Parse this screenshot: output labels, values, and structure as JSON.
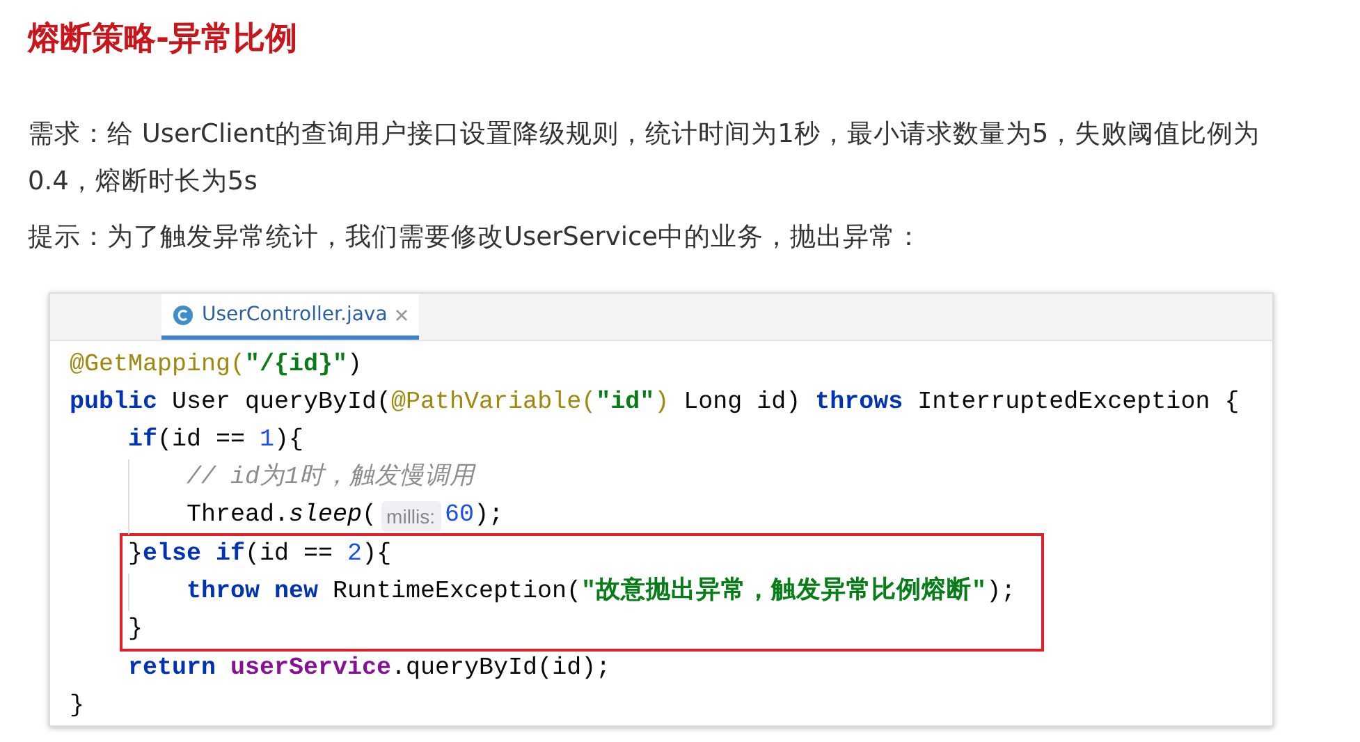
{
  "title": "熔断策略-异常比例",
  "paragraphs": [
    {
      "text": "需求：给 UserClient的查询用户接口设置降级规则，统计时间为1秒，最小请求数量为5，失败阈值比例为0.4，熔断时长为5s"
    },
    {
      "text": "提示：为了触发异常统计，我们需要修改UserService中的业务，抛出异常："
    }
  ],
  "editor": {
    "tabs": [
      {
        "label": "UserController.java",
        "selected": true
      }
    ],
    "lines": [
      {
        "highlighted": false,
        "tokens": [
          {
            "kind": "annotation",
            "text": "@GetMapping("
          },
          {
            "kind": "string",
            "text": "\"/{id}\""
          },
          {
            "kind": "plain",
            "text": ")"
          }
        ]
      },
      {
        "highlighted": false,
        "tokens": [
          {
            "kind": "keyword",
            "text": "public"
          },
          {
            "kind": "plain",
            "text": " User queryById("
          },
          {
            "kind": "annotation",
            "text": "@PathVariable("
          },
          {
            "kind": "string",
            "text": "\"id\""
          },
          {
            "kind": "annotation",
            "text": ")"
          },
          {
            "kind": "plain",
            "text": " Long id) "
          },
          {
            "kind": "keyword",
            "text": "throws"
          },
          {
            "kind": "plain",
            "text": " InterruptedException {"
          }
        ],
        "children": [
          {
            "highlighted": false,
            "tokens": [
              {
                "kind": "keyword",
                "text": "if"
              },
              {
                "kind": "plain",
                "text": "(id == "
              },
              {
                "kind": "number",
                "text": "1"
              },
              {
                "kind": "plain",
                "text": "){"
              }
            ],
            "children": [
              {
                "highlighted": false,
                "tokens": [
                  {
                    "kind": "comment",
                    "text": "// id为1时，触发慢调用"
                  }
                ]
              },
              {
                "highlighted": false,
                "tokens": [
                  {
                    "kind": "plain",
                    "text": "Thread."
                  },
                  {
                    "kind": "method",
                    "text": "sleep"
                  },
                  {
                    "kind": "plain",
                    "text": "("
                  },
                  {
                    "kind": "hint",
                    "text": "millis:"
                  },
                  {
                    "kind": "number",
                    "text": "60"
                  },
                  {
                    "kind": "plain",
                    "text": ");"
                  }
                ]
              }
            ]
          },
          {
            "highlighted": true,
            "tokens": [
              {
                "kind": "plain",
                "text": "}"
              },
              {
                "kind": "keyword",
                "text": "else if"
              },
              {
                "kind": "plain",
                "text": "(id == "
              },
              {
                "kind": "number",
                "text": "2"
              },
              {
                "kind": "plain",
                "text": "){"
              }
            ],
            "children": [
              {
                "highlighted": true,
                "tokens": [
                  {
                    "kind": "keyword",
                    "text": "throw new"
                  },
                  {
                    "kind": "plain",
                    "text": " RuntimeException("
                  },
                  {
                    "kind": "string",
                    "text": "\"故意抛出异常，触发异常比例熔断\""
                  },
                  {
                    "kind": "plain",
                    "text": ");"
                  }
                ]
              }
            ]
          },
          {
            "highlighted": true,
            "tokens": [
              {
                "kind": "plain",
                "text": "}"
              }
            ]
          },
          {
            "highlighted": false,
            "tokens": [
              {
                "kind": "keyword",
                "text": "return"
              },
              {
                "kind": "field",
                "text": " userService"
              },
              {
                "kind": "plain",
                "text": ".queryById(id);"
              }
            ]
          }
        ]
      },
      {
        "highlighted": false,
        "tokens": [
          {
            "kind": "plain",
            "text": "}"
          }
        ]
      }
    ]
  }
}
